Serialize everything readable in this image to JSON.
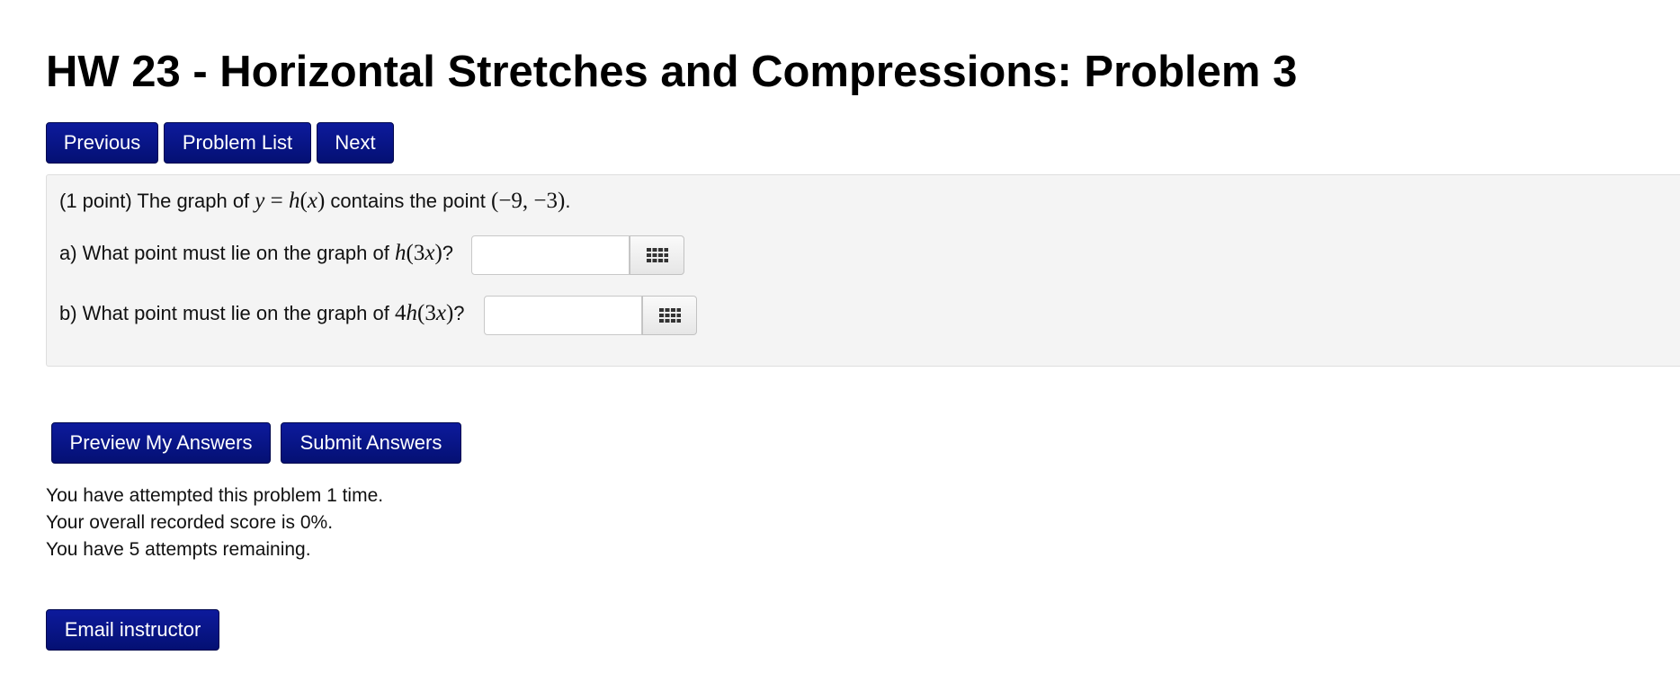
{
  "header": {
    "title": "HW 23 - Horizontal Stretches and Compressions: Problem 3"
  },
  "nav": {
    "previous": "Previous",
    "problem_list": "Problem List",
    "next": "Next"
  },
  "problem": {
    "intro_prefix": "(1 point) The graph of",
    "intro_mid": "contains the point",
    "intro_suffix": ".",
    "intro_function": {
      "y": "y",
      "eq": " = ",
      "h": "h",
      "x": "x"
    },
    "intro_point": "(−9, −3)",
    "part_a": {
      "prefix": "a) What point must lie on the graph of",
      "coef": "",
      "h": "h",
      "arg_open": "(3",
      "x": "x",
      "arg_close": ")",
      "suffix": "?",
      "value": ""
    },
    "part_b": {
      "prefix": "b) What point must lie on the graph of",
      "coef": "4",
      "h": "h",
      "arg_open": "(3",
      "x": "x",
      "arg_close": ")",
      "suffix": "?",
      "value": ""
    },
    "keyboard_icon": "keyboard-grid-icon"
  },
  "actions": {
    "preview": "Preview My Answers",
    "submit": "Submit Answers"
  },
  "status": {
    "attempts_line": "You have attempted this problem 1 time.",
    "score_line": "Your overall recorded score is 0%.",
    "remaining_line": "You have 5 attempts remaining."
  },
  "footer": {
    "email": "Email instructor"
  },
  "colors": {
    "button_bg": "#0a1588",
    "panel_bg": "#f4f4f4"
  }
}
